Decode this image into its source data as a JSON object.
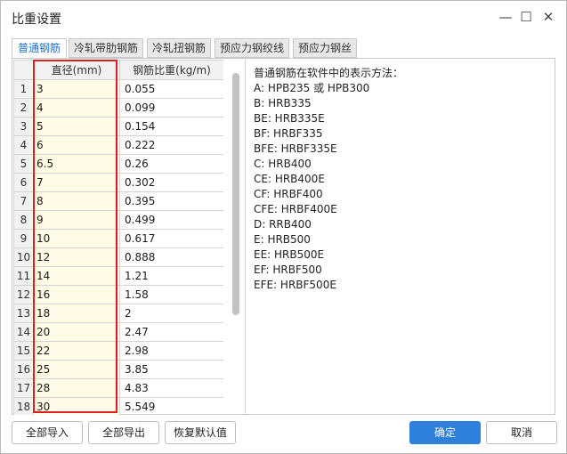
{
  "window": {
    "title": "比重设置",
    "minimize": "—",
    "maximize": "☐",
    "close": "✕"
  },
  "tabs": [
    "普通钢筋",
    "冷轧带肋钢筋",
    "冷轧扭钢筋",
    "预应力钢绞线",
    "预应力钢丝"
  ],
  "table": {
    "headers": [
      "",
      "直径(mm)",
      "钢筋比重(kg/m)"
    ],
    "rows": [
      [
        "1",
        "3",
        "0.055"
      ],
      [
        "2",
        "4",
        "0.099"
      ],
      [
        "3",
        "5",
        "0.154"
      ],
      [
        "4",
        "6",
        "0.222"
      ],
      [
        "5",
        "6.5",
        "0.26"
      ],
      [
        "6",
        "7",
        "0.302"
      ],
      [
        "7",
        "8",
        "0.395"
      ],
      [
        "8",
        "9",
        "0.499"
      ],
      [
        "9",
        "10",
        "0.617"
      ],
      [
        "10",
        "12",
        "0.888"
      ],
      [
        "11",
        "14",
        "1.21"
      ],
      [
        "12",
        "16",
        "1.58"
      ],
      [
        "13",
        "18",
        "2"
      ],
      [
        "14",
        "20",
        "2.47"
      ],
      [
        "15",
        "22",
        "2.98"
      ],
      [
        "16",
        "25",
        "3.85"
      ],
      [
        "17",
        "28",
        "4.83"
      ],
      [
        "18",
        "30",
        "5.549"
      ]
    ]
  },
  "description": {
    "heading": "普通钢筋在软件中的表示方法：",
    "lines": [
      "A:    HPB235 或 HPB300",
      "B:    HRB335",
      "BE:  HRB335E",
      "BF:  HRBF335",
      "BFE: HRBF335E",
      "C:    HRB400",
      "CE:   HRB400E",
      "CF:   HRBF400",
      "CFE: HRBF400E",
      "D:    RRB400",
      "E:    HRB500",
      "EE:   HRB500E",
      "EF:   HRBF500",
      "EFE: HRBF500E"
    ]
  },
  "buttons": {
    "import_all": "全部导入",
    "export_all": "全部导出",
    "restore_default": "恢复默认值",
    "ok": "确定",
    "cancel": "取消"
  },
  "colors": {
    "accent": "#2f7fdc",
    "active_tab_text": "#1f6fd0",
    "highlight_border": "#e02020",
    "diameter_cell_bg": "#fffbe6"
  }
}
